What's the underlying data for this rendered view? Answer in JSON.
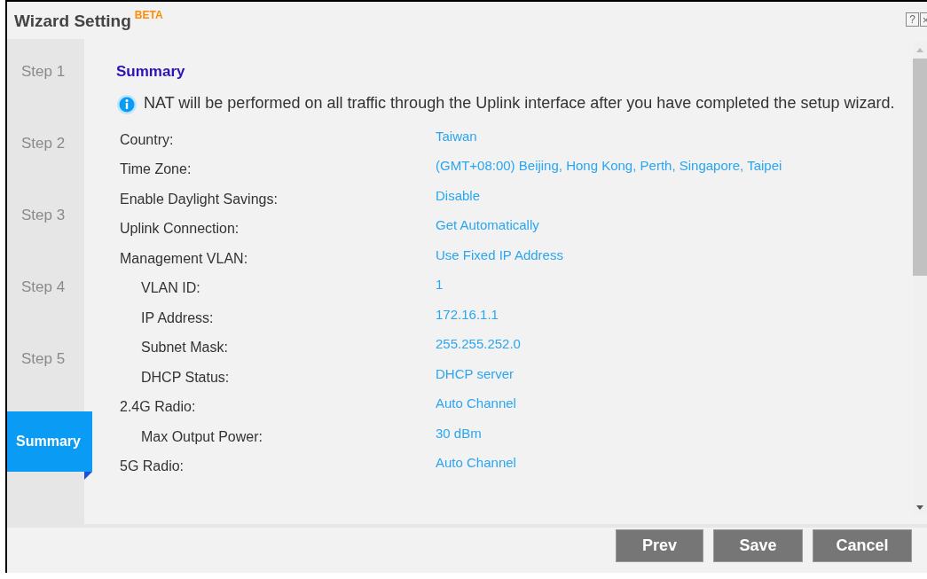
{
  "window": {
    "title": "Wizard Setting",
    "badge": "BETA",
    "help": "?",
    "close": "×"
  },
  "steps": [
    {
      "label": "Step 1",
      "selected": false
    },
    {
      "label": "Step 2",
      "selected": false
    },
    {
      "label": "Step 3",
      "selected": false
    },
    {
      "label": "Step 4",
      "selected": false
    },
    {
      "label": "Step 5",
      "selected": false
    },
    {
      "label": "Summary",
      "selected": true
    }
  ],
  "summary": {
    "heading": "Summary",
    "notice": "NAT will be performed on all traffic through the Uplink interface after you have completed the setup wizard.",
    "rows": [
      {
        "label": "Country:",
        "value": "Taiwan"
      },
      {
        "label": "Time Zone:",
        "value": "(GMT+08:00) Beijing, Hong Kong, Perth, Singapore, Taipei"
      },
      {
        "label": "Enable Daylight Savings:",
        "value": "Disable"
      },
      {
        "label": "Uplink Connection:",
        "value": "Get Automatically"
      },
      {
        "label": "Management VLAN:",
        "value": "Use Fixed IP Address",
        "children": [
          {
            "label": "VLAN ID:",
            "value": "1"
          },
          {
            "label": "IP Address:",
            "value": "172.16.1.1"
          },
          {
            "label": "Subnet Mask:",
            "value": "255.255.252.0"
          },
          {
            "label": "DHCP Status:",
            "value": "DHCP server"
          }
        ]
      },
      {
        "label": "2.4G Radio:",
        "value": "Auto Channel",
        "children": [
          {
            "label": "Max Output Power:",
            "value": "30 dBm"
          }
        ]
      },
      {
        "label": "5G Radio:",
        "value": "Auto Channel"
      }
    ]
  },
  "buttons": [
    "Prev",
    "Save",
    "Cancel"
  ]
}
